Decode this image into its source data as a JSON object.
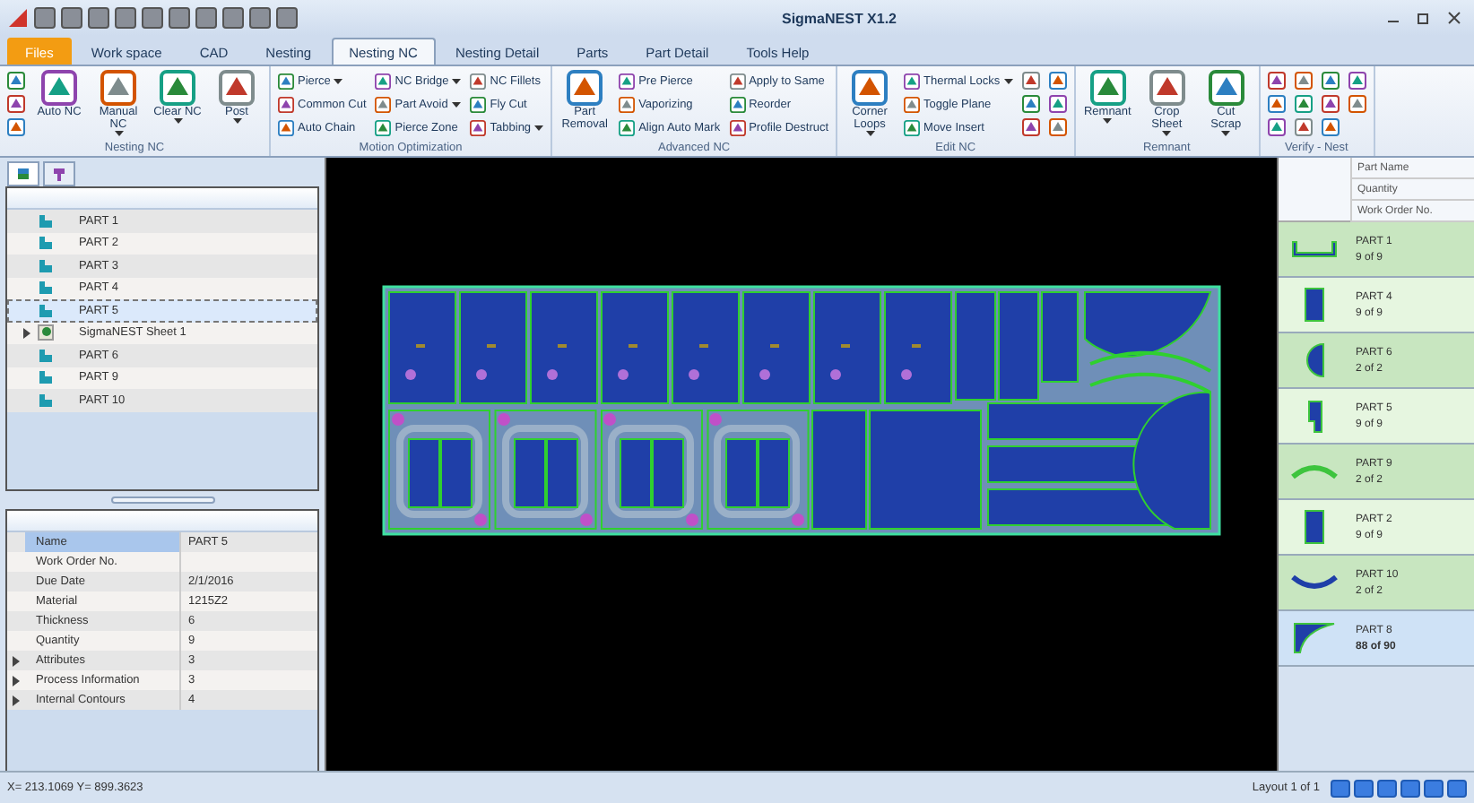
{
  "title_bar": {
    "title": "SigmaNEST X1.2"
  },
  "ribbon_tabs": [
    {
      "label": "Files",
      "selected": false,
      "kind": "app"
    },
    {
      "label": "Work space",
      "selected": false,
      "kind": "tab"
    },
    {
      "label": "CAD",
      "selected": false,
      "kind": "tab"
    },
    {
      "label": "Nesting",
      "selected": false,
      "kind": "tab"
    },
    {
      "label": "Nesting NC",
      "selected": true,
      "kind": "tab"
    },
    {
      "label": "Nesting Detail",
      "selected": false,
      "kind": "tab"
    },
    {
      "label": "Parts",
      "selected": false,
      "kind": "tab"
    },
    {
      "label": "Part Detail",
      "selected": false,
      "kind": "tab"
    },
    {
      "label": "Tools Help",
      "selected": false,
      "kind": "tab"
    }
  ],
  "ribbon_groups": [
    {
      "label": "Nesting NC",
      "columns": [
        [
          {
            "kind": "icon"
          },
          {
            "kind": "icon"
          },
          {
            "kind": "icon"
          }
        ],
        [
          {
            "kind": "large",
            "label": "Auto NC",
            "dropdown": false
          }
        ],
        [
          {
            "kind": "large",
            "label": "Manual NC",
            "dropdown": true
          }
        ],
        [
          {
            "kind": "large",
            "label": "Clear NC",
            "dropdown": true
          }
        ],
        [
          {
            "kind": "large",
            "label": "Post",
            "dropdown": true
          }
        ]
      ]
    },
    {
      "label": "Motion Optimization",
      "columns": [
        [
          {
            "kind": "small",
            "label": "Pierce",
            "dropdown": true
          },
          {
            "kind": "small",
            "label": "Common Cut",
            "dropdown": false
          },
          {
            "kind": "small",
            "label": "Auto Chain",
            "dropdown": false
          }
        ],
        [
          {
            "kind": "small",
            "label": "NC Bridge",
            "dropdown": true
          },
          {
            "kind": "small",
            "label": "Part Avoid",
            "dropdown": true
          },
          {
            "kind": "small",
            "label": "Pierce Zone",
            "dropdown": false
          }
        ],
        [
          {
            "kind": "small",
            "label": "NC Fillets",
            "dropdown": false
          },
          {
            "kind": "small",
            "label": "Fly Cut",
            "dropdown": false
          },
          {
            "kind": "small",
            "label": "Tabbing",
            "dropdown": true
          }
        ]
      ]
    },
    {
      "label": "Advanced NC",
      "columns": [
        [
          {
            "kind": "large",
            "label": "Part Removal",
            "dropdown": false
          }
        ],
        [
          {
            "kind": "small",
            "label": "Pre Pierce",
            "dropdown": false
          },
          {
            "kind": "small",
            "label": "Vaporizing",
            "dropdown": false
          },
          {
            "kind": "small",
            "label": "Align Auto Mark",
            "dropdown": false
          }
        ],
        [
          {
            "kind": "small",
            "label": "Apply to Same",
            "dropdown": false
          },
          {
            "kind": "small",
            "label": "Reorder",
            "dropdown": false
          },
          {
            "kind": "small",
            "label": "Profile Destruct",
            "dropdown": false
          }
        ]
      ]
    },
    {
      "label": "Edit NC",
      "columns": [
        [
          {
            "kind": "large",
            "label": "Corner Loops",
            "dropdown": true
          }
        ],
        [
          {
            "kind": "small",
            "label": "Thermal Locks",
            "dropdown": true
          },
          {
            "kind": "small",
            "label": "Toggle Plane",
            "dropdown": false
          },
          {
            "kind": "small",
            "label": "Move Insert",
            "dropdown": false
          }
        ],
        [
          {
            "kind": "icon"
          },
          {
            "kind": "icon"
          },
          {
            "kind": "icon"
          }
        ],
        [
          {
            "kind": "icon"
          },
          {
            "kind": "icon"
          },
          {
            "kind": "icon"
          }
        ]
      ]
    },
    {
      "label": "Remnant",
      "columns": [
        [
          {
            "kind": "large",
            "label": "Remnant",
            "dropdown": true
          }
        ],
        [
          {
            "kind": "large",
            "label": "Crop Sheet",
            "dropdown": true
          }
        ],
        [
          {
            "kind": "large",
            "label": "Cut Scrap",
            "dropdown": true
          }
        ]
      ]
    },
    {
      "label": "Verify - Nest",
      "columns": [
        [
          {
            "kind": "icon"
          },
          {
            "kind": "icon"
          },
          {
            "kind": "icon"
          }
        ],
        [
          {
            "kind": "icon"
          },
          {
            "kind": "icon"
          },
          {
            "kind": "icon"
          }
        ],
        [
          {
            "kind": "icon"
          },
          {
            "kind": "icon"
          },
          {
            "kind": "icon"
          }
        ],
        [
          {
            "kind": "icon"
          },
          {
            "kind": "icon"
          }
        ]
      ]
    }
  ],
  "part_tree": [
    {
      "label": "PART 1",
      "kind": "part",
      "selected": false
    },
    {
      "label": "PART 2",
      "kind": "part",
      "selected": false
    },
    {
      "label": "PART 3",
      "kind": "part",
      "selected": false
    },
    {
      "label": "PART 4",
      "kind": "part",
      "selected": false
    },
    {
      "label": "PART 5",
      "kind": "part",
      "selected": true
    },
    {
      "label": "SigmaNEST Sheet 1",
      "kind": "sheet",
      "selected": false
    },
    {
      "label": "PART 6",
      "kind": "part",
      "selected": false
    },
    {
      "label": "PART 9",
      "kind": "part",
      "selected": false
    },
    {
      "label": "PART 10",
      "kind": "part",
      "selected": false
    }
  ],
  "properties": [
    {
      "name": "Name",
      "value": "PART 5",
      "selected": true,
      "expandable": false
    },
    {
      "name": "Work Order No.",
      "selected": false,
      "expandable": false
    },
    {
      "name": "Due Date",
      "value": "2/1/2016",
      "selected": false,
      "expandable": false
    },
    {
      "name": "Material",
      "value": "1215Z2",
      "selected": false,
      "expandable": false
    },
    {
      "name": "Thickness",
      "value": "6",
      "selected": false,
      "expandable": false
    },
    {
      "name": "Quantity",
      "value": "9",
      "selected": false,
      "expandable": false
    },
    {
      "name": "Attributes",
      "value": "3",
      "selected": false,
      "expandable": true
    },
    {
      "name": "Process Information",
      "value": "3",
      "selected": false,
      "expandable": true
    },
    {
      "name": "Internal Contours",
      "value": "4",
      "selected": false,
      "expandable": true
    }
  ],
  "part_list": {
    "columns": [
      "Part Name",
      "Quantity",
      "Work Order No."
    ],
    "items": [
      {
        "name": "PART 1",
        "count": "9 of 9",
        "kind": "channel",
        "selected": false
      },
      {
        "name": "PART 4",
        "count": "9 of 9",
        "kind": "rect",
        "selected": false
      },
      {
        "name": "PART 6",
        "count": "2 of 2",
        "kind": "half",
        "selected": false
      },
      {
        "name": "PART 5",
        "count": "9 of 9",
        "kind": "notch",
        "selected": false
      },
      {
        "name": "PART 9",
        "count": "2 of 2",
        "kind": "arc",
        "selected": false
      },
      {
        "name": "PART 2",
        "count": "9 of 9",
        "kind": "rect",
        "selected": false
      },
      {
        "name": "PART 10",
        "count": "2 of 2",
        "kind": "smile",
        "selected": false
      },
      {
        "name": "PART 8",
        "count": "88 of 90",
        "kind": "corner",
        "selected": true
      }
    ]
  },
  "status_bar": {
    "coordinates": "X= 213.1069 Y= 899.3623",
    "layout": "Layout 1 of 1"
  }
}
